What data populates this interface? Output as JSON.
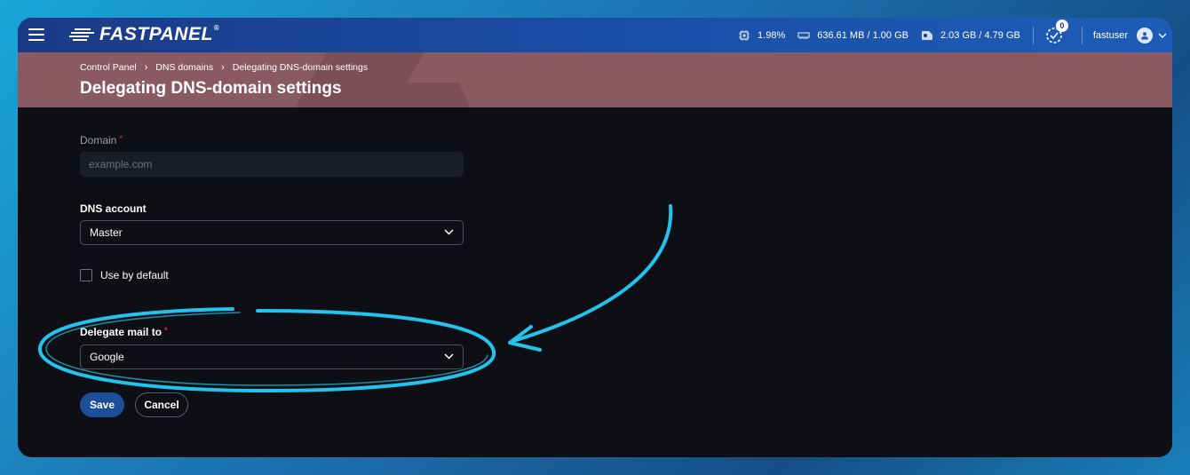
{
  "topbar": {
    "logo_text": "FASTPANEL",
    "logo_mark": "®",
    "cpu": "1.98%",
    "memory": "636.61 MB / 1.00 GB",
    "disk": "2.03 GB / 4.79 GB",
    "tasks_count": "0",
    "username": "fastuser"
  },
  "header": {
    "breadcrumb": [
      "Control Panel",
      "DNS domains",
      "Delegating DNS-domain settings"
    ],
    "title": "Delegating DNS-domain settings"
  },
  "form": {
    "domain_label": "Domain",
    "domain_placeholder": "example.com",
    "dns_account_label": "DNS account",
    "dns_account_value": "Master",
    "use_by_default_label": "Use by default",
    "use_by_default_checked": false,
    "delegate_mail_label": "Delegate mail to",
    "delegate_mail_value": "Google",
    "required_mark": "*",
    "save_label": "Save",
    "cancel_label": "Cancel"
  },
  "colors": {
    "accent": "#1d4e9a",
    "header_bg": "#8a5a63",
    "annotation": "#22c3ee",
    "required": "#e0364b"
  }
}
